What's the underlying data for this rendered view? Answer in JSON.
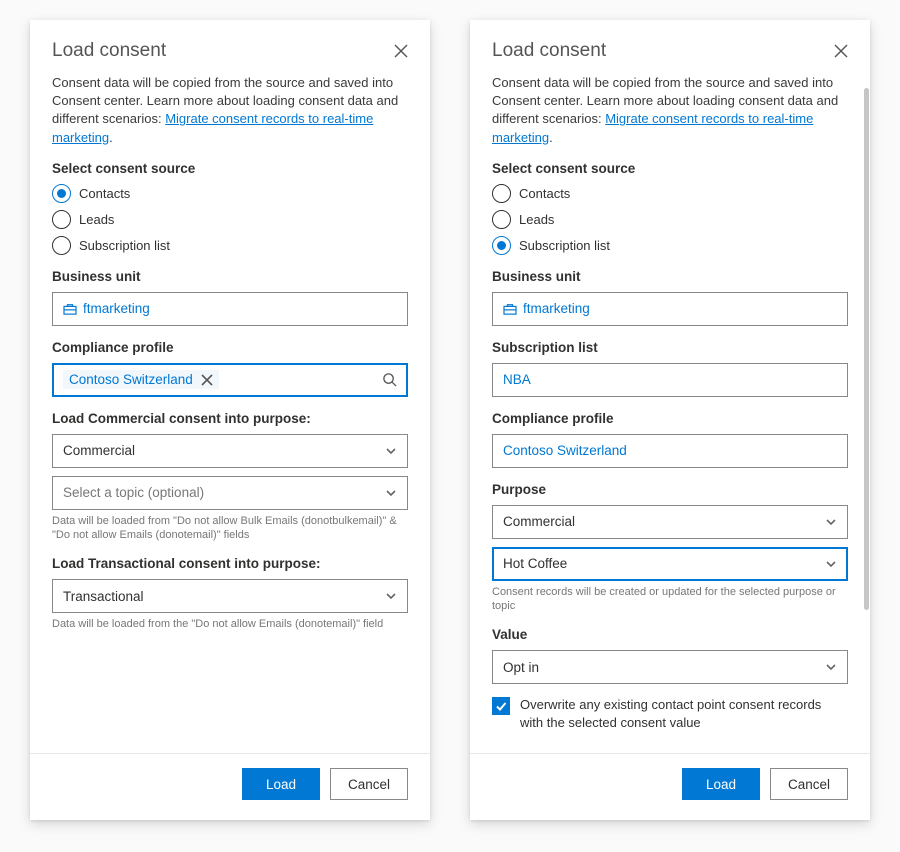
{
  "shared": {
    "title": "Load consent",
    "intro_prefix": "Consent data will be copied from the source and saved into Consent center. Learn more about loading consent data and different scenarios: ",
    "intro_link": "Migrate consent records to real-time marketing",
    "intro_suffix": ".",
    "select_source_label": "Select consent source",
    "radio_contacts": "Contacts",
    "radio_leads": "Leads",
    "radio_sublist": "Subscription list",
    "business_unit_label": "Business unit",
    "business_unit_value": "ftmarketing",
    "compliance_label": "Compliance profile",
    "compliance_value": "Contoso Switzerland",
    "load_btn": "Load",
    "cancel_btn": "Cancel"
  },
  "left": {
    "load_commercial_label": "Load Commercial consent into purpose:",
    "commercial_value": "Commercial",
    "topic_placeholder": "Select a topic (optional)",
    "commercial_hint": "Data will be loaded from \"Do not allow Bulk Emails (donotbulkemail)\" & \"Do not allow Emails (donotemail)\" fields",
    "load_transactional_label": "Load Transactional consent into purpose:",
    "transactional_value": "Transactional",
    "transactional_hint": "Data will be loaded from the \"Do not allow Emails (donotemail)\" field"
  },
  "right": {
    "sublist_label": "Subscription list",
    "sublist_value": "NBA",
    "purpose_label": "Purpose",
    "purpose_value": "Commercial",
    "purpose_topic_value": "Hot Coffee",
    "purpose_hint": "Consent records will be created or updated for the selected purpose or topic",
    "value_label": "Value",
    "value_value": "Opt in",
    "overwrite_label": "Overwrite any existing contact point consent records with the selected consent value"
  }
}
